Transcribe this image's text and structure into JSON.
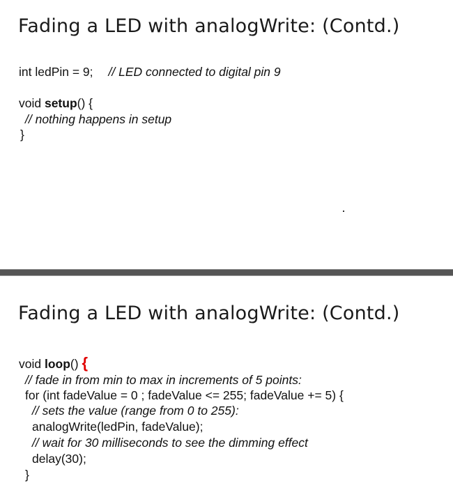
{
  "slide1": {
    "title": "Fading a LED with analogWrite: (Contd.)",
    "decl_code": "int ledPin = 9;",
    "decl_comment": "// LED connected to digital pin 9",
    "setup_prefix": "void ",
    "setup_name": "setup",
    "setup_suffix": "() {",
    "setup_comment": "// nothing happens in setup",
    "setup_close": "}"
  },
  "slide2": {
    "title": "Fading a LED with analogWrite: (Contd.)",
    "loop_prefix": "void ",
    "loop_name": "loop",
    "loop_suffix": "() ",
    "loop_open": "{",
    "comment_fade": "// fade in from min to max in increments of 5 points:",
    "for_line": "for (int fadeValue = 0 ; fadeValue <= 255; fadeValue += 5) {",
    "comment_sets": "// sets the value (range from 0 to 255):",
    "write_line": "analogWrite(ledPin, fadeValue);",
    "comment_wait": "// wait for 30 milliseconds to see the dimming effect",
    "delay_line": "delay(30);",
    "close_brace": "}"
  },
  "colors": {
    "divider": "#555555",
    "highlight_brace": "#e00000"
  }
}
